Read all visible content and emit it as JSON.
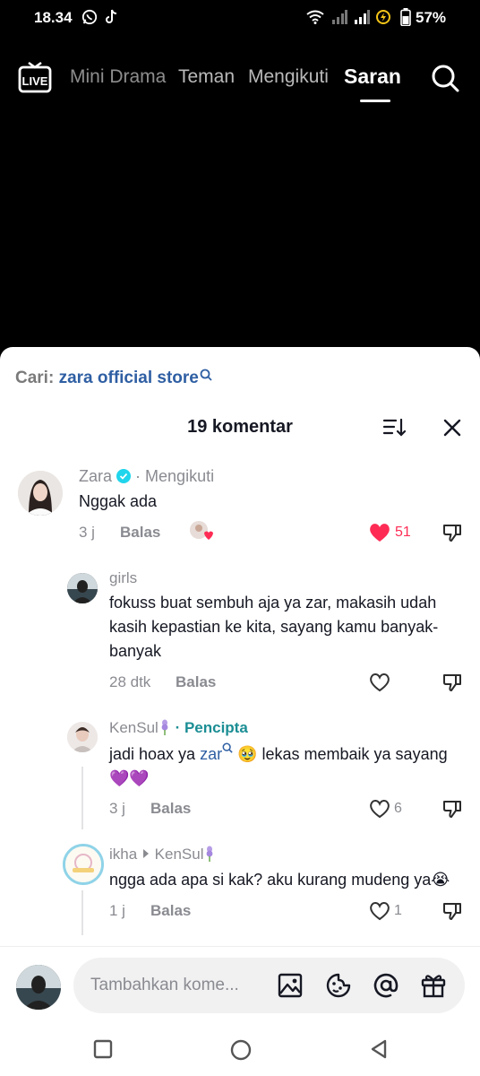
{
  "status": {
    "time": "18.34",
    "battery": "57%"
  },
  "topnav": {
    "live_label": "LIVE",
    "tabs": [
      "Mini Drama",
      "Teman",
      "Mengikuti",
      "Saran"
    ]
  },
  "sheet": {
    "search_prefix": "Cari: ",
    "search_query": "zara official store",
    "comment_count": "19 komentar",
    "comments": [
      {
        "user": "Zara",
        "badge": "· Mengikuti",
        "text": "Nggak ada",
        "time": "3 j",
        "reply": "Balas",
        "likes": "51"
      },
      {
        "user": "girls",
        "text": "fokuss buat sembuh aja ya zar, makasih udah kasih kepastian ke kita, sayang kamu banyak-banyak",
        "time": "28 dtk",
        "reply": "Balas"
      },
      {
        "user": "KenSul",
        "badge": "· Pencipta",
        "text_before": "jadi hoax ya ",
        "mention": "zar",
        "text_after": " 🥹 lekas membaik ya sayang 💜💜",
        "time": "3 j",
        "reply": "Balas",
        "likes": "6"
      },
      {
        "user": "ikha",
        "reply_to": "KenSul",
        "text": "ngga ada apa si kak? aku kurang mudeng ya😭",
        "time": "1 j",
        "reply": "Balas",
        "likes": "1"
      }
    ]
  },
  "input": {
    "placeholder": "Tambahkan kome..."
  },
  "colors": {
    "accent_red": "#fe2c55",
    "mention_blue": "#2f5fa3",
    "creator_teal": "#1b8e94"
  }
}
